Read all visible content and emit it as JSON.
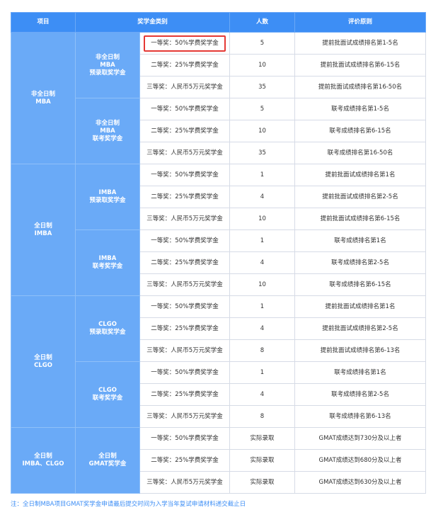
{
  "headers": [
    "项目",
    "奖学金类别",
    "人数",
    "评价原则"
  ],
  "groups": [
    {
      "name": [
        "非全日制",
        "MBA"
      ],
      "subs": [
        {
          "name": [
            "非全日制",
            "MBA",
            "预录取奖学金"
          ],
          "rows": [
            {
              "award": "一等奖：50%学费奖学金",
              "count": "5",
              "rule": "提前批面试成绩排名第1-5名"
            },
            {
              "award": "二等奖：25%学费奖学金",
              "count": "10",
              "rule": "提前批面试成绩排名第6-15名"
            },
            {
              "award": "三等奖：人民币5万元奖学金",
              "count": "35",
              "rule": "提前批面试成绩排名第16-50名"
            }
          ]
        },
        {
          "name": [
            "非全日制",
            "MBA",
            "联考奖学金"
          ],
          "rows": [
            {
              "award": "一等奖：50%学费奖学金",
              "count": "5",
              "rule": "联考成绩排名第1-5名"
            },
            {
              "award": "二等奖：25%学费奖学金",
              "count": "10",
              "rule": "联考成绩排名第6-15名"
            },
            {
              "award": "三等奖：人民币5万元奖学金",
              "count": "35",
              "rule": "联考成绩排名第16-50名"
            }
          ]
        }
      ]
    },
    {
      "name": [
        "全日制",
        "IMBA"
      ],
      "subs": [
        {
          "name": [
            "IMBA",
            "预录取奖学金"
          ],
          "rows": [
            {
              "award": "一等奖：50%学费奖学金",
              "count": "1",
              "rule": "提前批面试成绩排名第1名"
            },
            {
              "award": "二等奖：25%学费奖学金",
              "count": "4",
              "rule": "提前批面试成绩排名第2-5名"
            },
            {
              "award": "三等奖：人民币5万元奖学金",
              "count": "10",
              "rule": "提前批面试成绩排名第6-15名"
            }
          ]
        },
        {
          "name": [
            "IMBA",
            "联考奖学金"
          ],
          "rows": [
            {
              "award": "一等奖：50%学费奖学金",
              "count": "1",
              "rule": "联考成绩排名第1名"
            },
            {
              "award": "二等奖：25%学费奖学金",
              "count": "4",
              "rule": "联考成绩排名第2-5名"
            },
            {
              "award": "三等奖：人民币5万元奖学金",
              "count": "10",
              "rule": "联考成绩排名第6-15名"
            }
          ]
        }
      ]
    },
    {
      "name": [
        "全日制",
        "CLGO"
      ],
      "subs": [
        {
          "name": [
            "CLGO",
            "预录取奖学金"
          ],
          "rows": [
            {
              "award": "一等奖：50%学费奖学金",
              "count": "1",
              "rule": "提前批面试成绩排名第1名"
            },
            {
              "award": "二等奖：25%学费奖学金",
              "count": "4",
              "rule": "提前批面试成绩排名第2-5名"
            },
            {
              "award": "三等奖：人民币5万元奖学金",
              "count": "8",
              "rule": "提前批面试成绩排名第6-13名"
            }
          ]
        },
        {
          "name": [
            "CLGO",
            "联考奖学金"
          ],
          "rows": [
            {
              "award": "一等奖：50%学费奖学金",
              "count": "1",
              "rule": "联考成绩排名第1名"
            },
            {
              "award": "二等奖：25%学费奖学金",
              "count": "4",
              "rule": "联考成绩排名第2-5名"
            },
            {
              "award": "三等奖：人民币5万元奖学金",
              "count": "8",
              "rule": "联考成绩排名第6-13名"
            }
          ]
        }
      ]
    },
    {
      "name": [
        "全日制",
        "IMBA、CLGO"
      ],
      "subs": [
        {
          "name": [
            "全日制",
            "GMAT奖学金"
          ],
          "rows": [
            {
              "award": "一等奖：50%学费奖学金",
              "count": "实际录取",
              "rule": "GMAT成绩达到730分及以上者"
            },
            {
              "award": "二等奖：25%学费奖学金",
              "count": "实际录取",
              "rule": "GMAT成绩达到680分及以上者"
            },
            {
              "award": "三等奖：人民币5万元奖学金",
              "count": "实际录取",
              "rule": "GMAT成绩达到630分及以上者"
            }
          ]
        }
      ]
    }
  ],
  "note": "注：全日制MBA项目GMAT奖学金申请最后提交时间为入学当年复试申请材料递交截止日"
}
